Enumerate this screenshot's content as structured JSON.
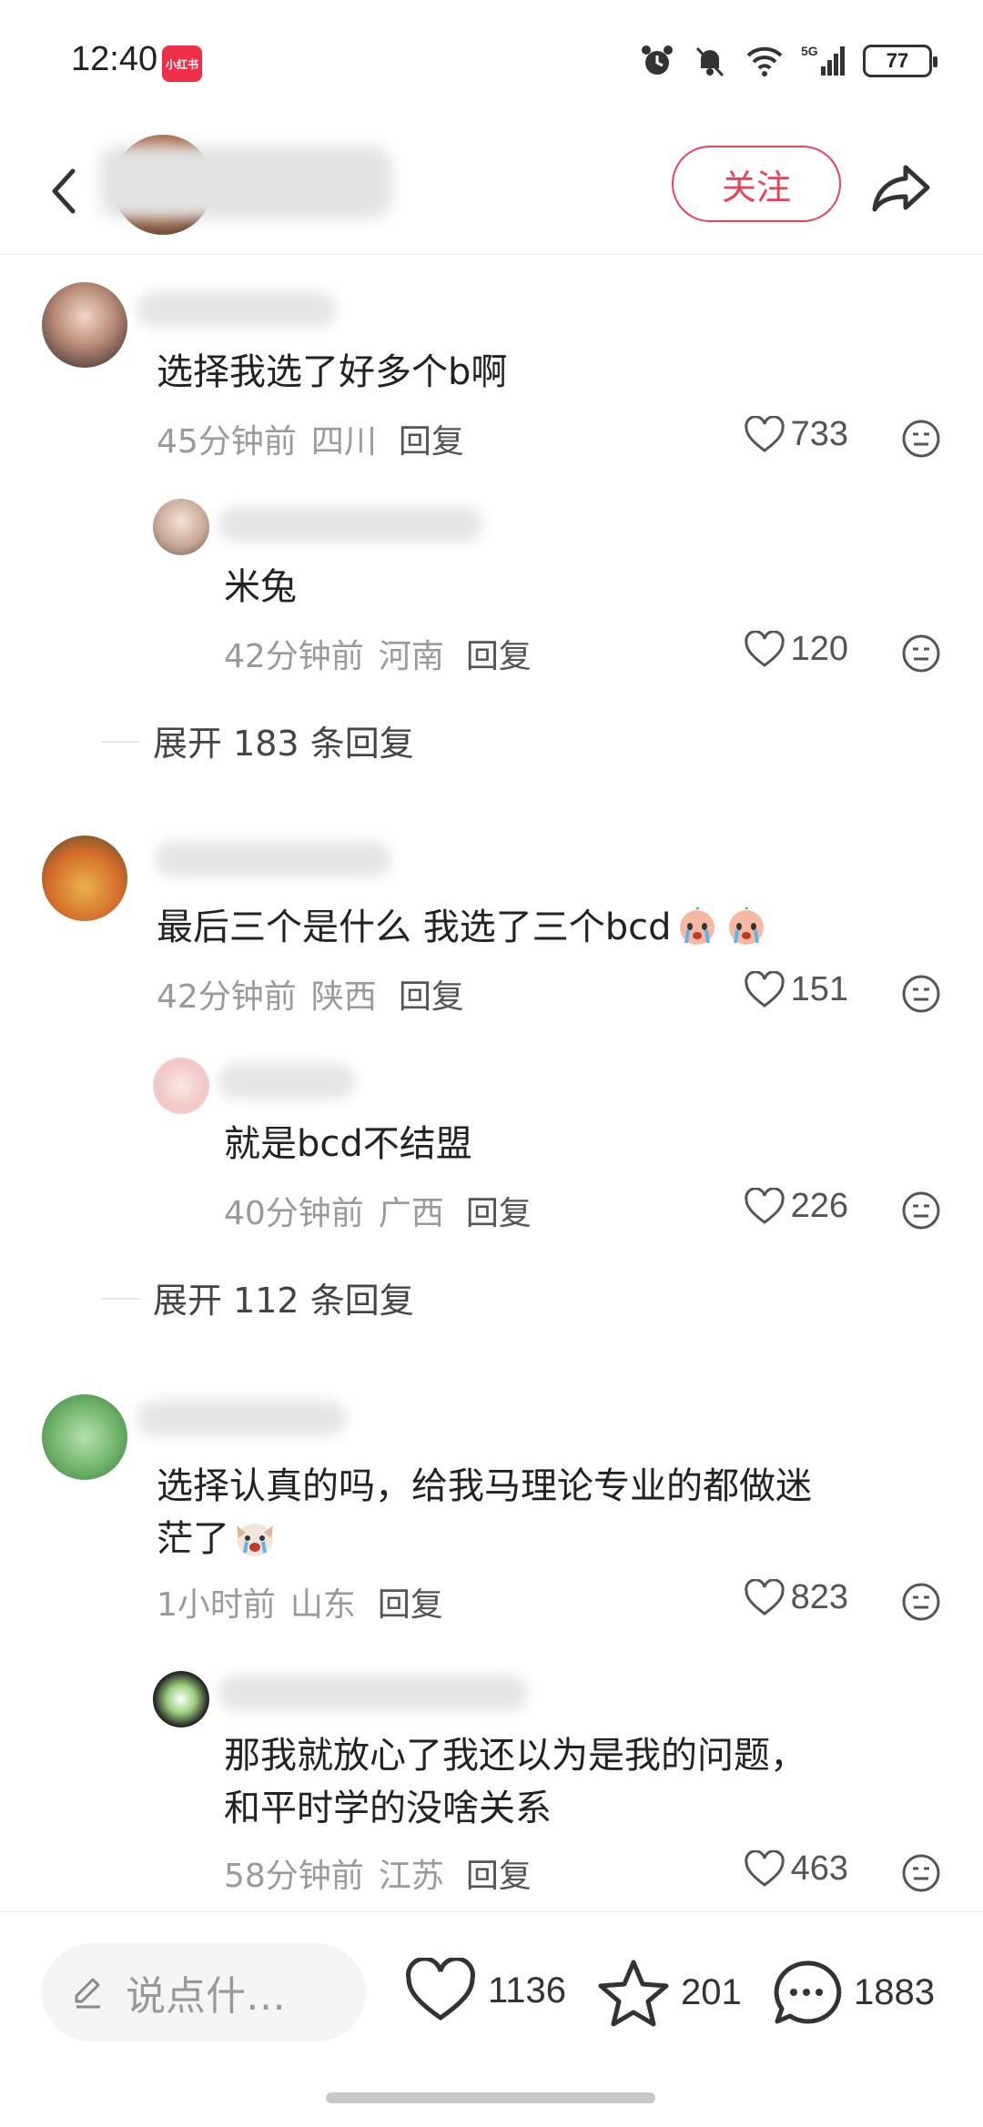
{
  "status_bar": {
    "time": "12:40",
    "app_badge": "小红书",
    "battery": "77",
    "network": "5G"
  },
  "header": {
    "follow_label": "关注"
  },
  "comments": [
    {
      "text": "选择我选了好多个b啊",
      "time": "45分钟前",
      "location": "四川",
      "reply_label": "回复",
      "likes": "733",
      "replies": [
        {
          "text": "米兔",
          "time": "42分钟前",
          "location": "河南",
          "reply_label": "回复",
          "likes": "120"
        }
      ],
      "expand_label": "展开 183 条回复"
    },
    {
      "text": "最后三个是什么 我选了三个bcd",
      "time": "42分钟前",
      "location": "陕西",
      "reply_label": "回复",
      "likes": "151",
      "replies": [
        {
          "text": "就是bcd不结盟",
          "time": "40分钟前",
          "location": "广西",
          "reply_label": "回复",
          "likes": "226"
        }
      ],
      "expand_label": "展开 112 条回复"
    },
    {
      "text": "选择认真的吗，给我马理论专业的都做迷茫了",
      "text_line1": "选择认真的吗，给我马理论专业的都做迷",
      "text_line2": "茫了",
      "time": "1小时前",
      "location": "山东",
      "reply_label": "回复",
      "likes": "823",
      "replies": [
        {
          "text_line1": "那我就放心了我还以为是我的问题，",
          "text_line2": "和平时学的没啥关系",
          "time": "58分钟前",
          "location": "江苏",
          "reply_label": "回复",
          "likes": "463"
        }
      ]
    }
  ],
  "bottom_bar": {
    "input_placeholder": "说点什…",
    "likes": "1136",
    "collects": "201",
    "comments": "1883"
  },
  "colors": {
    "accent": "#e9435a",
    "muted": "#9a9a9a",
    "text": "#222222"
  }
}
